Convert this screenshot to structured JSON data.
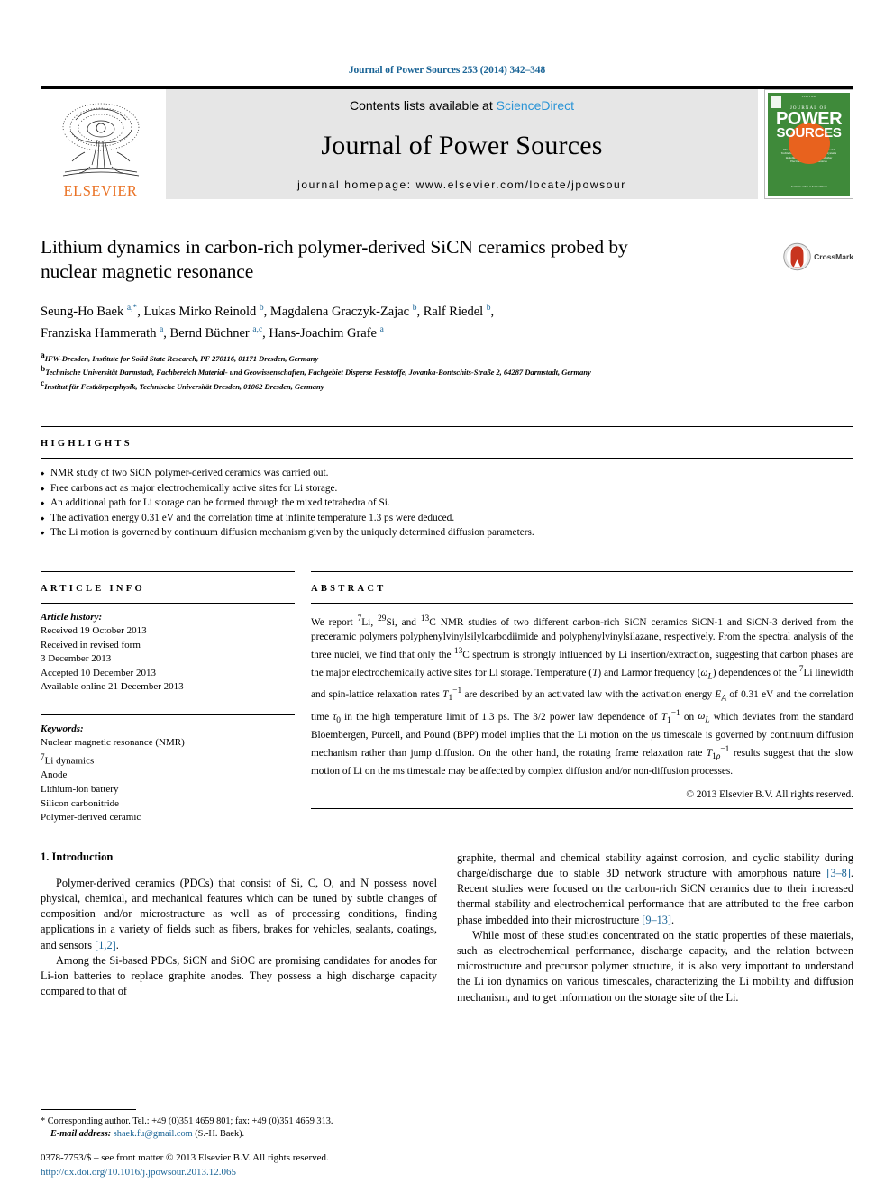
{
  "running_head": "Journal of Power Sources 253 (2014) 342–348",
  "masthead": {
    "contents_prefix": "Contents lists available at ",
    "contents_link": "ScienceDirect",
    "journal_title": "Journal of Power Sources",
    "homepage": "journal homepage: www.elsevier.com/locate/jpowsour",
    "publisher": "ELSEVIER",
    "cover": {
      "journal_of": "JOURNAL OF",
      "word1": "POWER",
      "word2": "SOURCES",
      "subtitle": "The International Journal on the Science and Technology of Electrochemical Energy Systems including Batteries, Fuel Cells and other Electrochemical Power Sources",
      "footer": "Available online at\nScienceDirect",
      "top_strip": "ELSEVIER"
    }
  },
  "article": {
    "title": "Lithium dynamics in carbon-rich polymer-derived SiCN ceramics probed by nuclear magnetic resonance",
    "crossmark_label": "CrossMark",
    "authors_line1": "Seung-Ho Baek a,*, Lukas Mirko Reinold b, Magdalena Graczyk-Zajac b, Ralf Riedel b,",
    "authors_line2": "Franziska Hammerath a, Bernd Büchner a,c, Hans-Joachim Grafe a",
    "affiliations": [
      "a IFW-Dresden, Institute for Solid State Research, PF 270116, 01171 Dresden, Germany",
      "b Technische Universität Darmstadt, Fachbereich Material- und Geowissenschaften, Fachgebiet Disperse Feststoffe, Jovanka-Bontschits-Straße 2, 64287 Darmstadt, Germany",
      "c Institut für Festkörperphysik, Technische Universität Dresden, 01062 Dresden, Germany"
    ]
  },
  "highlights": {
    "label": "HIGHLIGHTS",
    "items": [
      "NMR study of two SiCN polymer-derived ceramics was carried out.",
      "Free carbons act as major electrochemically active sites for Li storage.",
      "An additional path for Li storage can be formed through the mixed tetrahedra of Si.",
      "The activation energy 0.31 eV and the correlation time at infinite temperature 1.3 ps were deduced.",
      "The Li motion is governed by continuum diffusion mechanism given by the uniquely determined diffusion parameters."
    ]
  },
  "article_info": {
    "label": "ARTICLE INFO",
    "history_heading": "Article history:",
    "history": [
      "Received 19 October 2013",
      "Received in revised form",
      "3 December 2013",
      "Accepted 10 December 2013",
      "Available online 21 December 2013"
    ],
    "keywords_heading": "Keywords:",
    "keywords": [
      "Nuclear magnetic resonance (NMR)",
      "7Li dynamics",
      "Anode",
      "Lithium-ion battery",
      "Silicon carbonitride",
      "Polymer-derived ceramic"
    ]
  },
  "abstract": {
    "label": "ABSTRACT",
    "text": "We report 7Li, 29Si, and 13C NMR studies of two different carbon-rich SiCN ceramics SiCN-1 and SiCN-3 derived from the preceramic polymers polyphenylvinylsilylcarbodiimide and polyphenylvinylsilazane, respectively. From the spectral analysis of the three nuclei, we find that only the 13C spectrum is strongly influenced by Li insertion/extraction, suggesting that carbon phases are the major electrochemically active sites for Li storage. Temperature (T) and Larmor frequency (ωL) dependences of the 7Li linewidth and spin-lattice relaxation rates T1−1 are described by an activated law with the activation energy EA of 0.31 eV and the correlation time τ0 in the high temperature limit of 1.3 ps. The 3/2 power law dependence of T1−1 on ωL which deviates from the standard Bloembergen, Purcell, and Pound (BPP) model implies that the Li motion on the μs timescale is governed by continuum diffusion mechanism rather than jump diffusion. On the other hand, the rotating frame relaxation rate T1ρ−1 results suggest that the slow motion of Li on the ms timescale may be affected by complex diffusion and/or non-diffusion processes.",
    "copyright": "© 2013 Elsevier B.V. All rights reserved."
  },
  "introduction": {
    "heading": "1. Introduction",
    "left_paragraph_1": "Polymer-derived ceramics (PDCs) that consist of Si, C, O, and N possess novel physical, chemical, and mechanical features which can be tuned by subtle changes of composition and/or microstructure as well as of processing conditions, finding applications in a variety of fields such as fibers, brakes for vehicles, sealants, coatings, and sensors ",
    "left_ref_1": "[1,2]",
    "left_paragraph_1_end": ".",
    "left_paragraph_2": "Among the Si-based PDCs, SiCN and SiOC are promising candidates for anodes for Li-ion batteries to replace graphite anodes. They possess a high discharge capacity compared to that of",
    "right_paragraph_1a": "graphite, thermal and chemical stability against corrosion, and cyclic stability during charge/discharge due to stable 3D network structure with amorphous nature ",
    "right_ref_1": "[3–8]",
    "right_paragraph_1b": ". Recent studies were focused on the carbon-rich SiCN ceramics due to their increased thermal stability and electrochemical performance that are attributed to the free carbon phase imbedded into their microstructure ",
    "right_ref_2": "[9–13]",
    "right_paragraph_1c": ".",
    "right_paragraph_2": "While most of these studies concentrated on the static properties of these materials, such as electrochemical performance, discharge capacity, and the relation between microstructure and precursor polymer structure, it is also very important to understand the Li ion dynamics on various timescales, characterizing the Li mobility and diffusion mechanism, and to get information on the storage site of the Li."
  },
  "footer": {
    "corresponding": "* Corresponding author. Tel.: +49 (0)351 4659 801; fax: +49 (0)351 4659 313.",
    "email_label": "E-mail address:",
    "email": "shaek.fu@gmail.com",
    "email_suffix": "(S.-H. Baek).",
    "issn": "0378-7753/$ – see front matter © 2013 Elsevier B.V. All rights reserved.",
    "doi": "http://dx.doi.org/10.1016/j.jpowsour.2013.12.065"
  },
  "colors": {
    "link": "#1a6496",
    "sciencedirect": "#2a94d6",
    "elsevier_orange": "#ea7326",
    "cover_green": "#3f8a3a",
    "crossmark_red": "#c8341f"
  }
}
